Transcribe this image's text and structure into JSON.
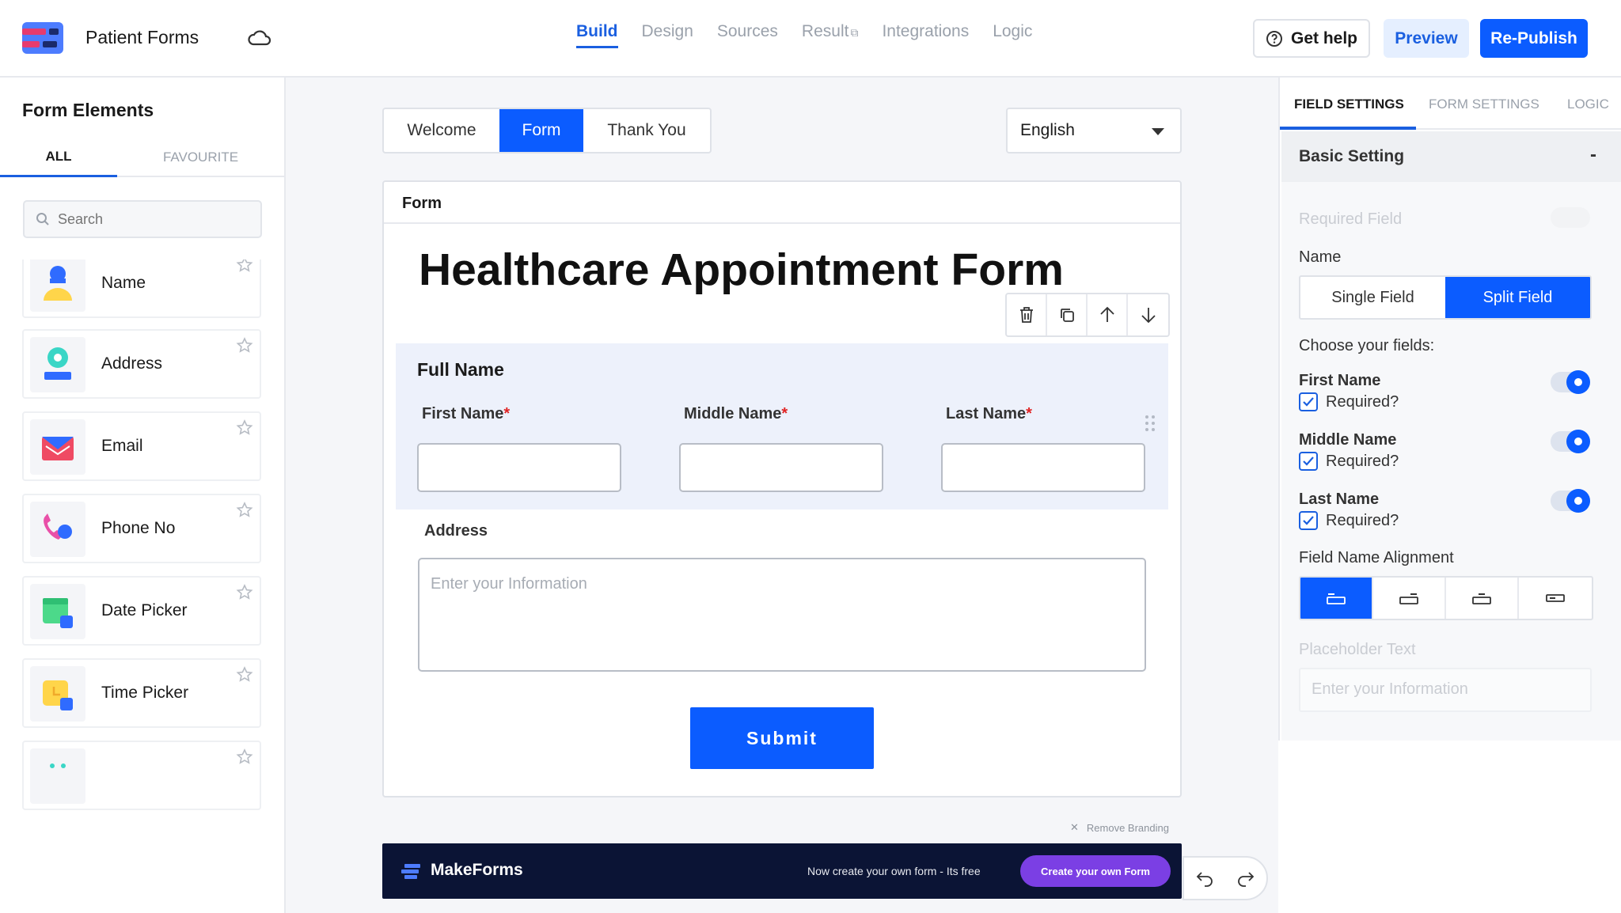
{
  "app": {
    "title": "Patient Forms"
  },
  "nav": {
    "tabs": [
      {
        "label": "Build",
        "active": true
      },
      {
        "label": "Design",
        "active": false
      },
      {
        "label": "Sources",
        "active": false
      },
      {
        "label": "Result",
        "active": false,
        "external": true
      },
      {
        "label": "Integrations",
        "active": false
      },
      {
        "label": "Logic",
        "active": false
      }
    ]
  },
  "header": {
    "help_label": "Get help",
    "preview_label": "Preview",
    "publish_label": "Re-Publish"
  },
  "left_panel": {
    "title": "Form Elements",
    "tabs": {
      "all": "ALL",
      "favourite": "FAVOURITE"
    },
    "search_placeholder": "Search",
    "elements": [
      {
        "label": "Name",
        "icon": "person-icon"
      },
      {
        "label": "Address",
        "icon": "location-icon"
      },
      {
        "label": "Email",
        "icon": "envelope-icon"
      },
      {
        "label": "Phone No",
        "icon": "phone-icon"
      },
      {
        "label": "Date Picker",
        "icon": "calendar-icon"
      },
      {
        "label": "Time Picker",
        "icon": "clock-icon"
      },
      {
        "label": "",
        "icon": "partial-icon"
      }
    ]
  },
  "canvas": {
    "steps": [
      {
        "label": "Welcome",
        "active": false
      },
      {
        "label": "Form",
        "active": true
      },
      {
        "label": "Thank You",
        "active": false
      }
    ],
    "language": "English",
    "card_label": "Form",
    "form_title": "Healthcare Appointment Form",
    "full_name": {
      "title": "Full Name",
      "fields": [
        {
          "label": "First Name",
          "required_mark": "*"
        },
        {
          "label": "Middle Name",
          "required_mark": "*"
        },
        {
          "label": "Last Name",
          "required_mark": "*"
        }
      ]
    },
    "address": {
      "label": "Address",
      "placeholder": "Enter your Information"
    },
    "submit_label": "Submit",
    "remove_branding": "Remove Branding"
  },
  "footer": {
    "brand": "MakeForms",
    "tagline": "Now create your own form - Its free",
    "cta": "Create your own Form"
  },
  "right_panel": {
    "tabs": [
      {
        "label": "FIELD SETTINGS",
        "active": true
      },
      {
        "label": "FORM SETTINGS",
        "active": false
      },
      {
        "label": "LOGIC",
        "active": false
      }
    ],
    "section_title": "Basic Setting",
    "collapse_symbol": "-",
    "required_field_label": "Required Field",
    "name_label": "Name",
    "name_modes": [
      {
        "label": "Single Field",
        "active": false
      },
      {
        "label": "Split Field",
        "active": true
      }
    ],
    "choose_label": "Choose your fields:",
    "fields": [
      {
        "name": "First Name",
        "required_label": "Required?",
        "enabled": true,
        "required": true
      },
      {
        "name": "Middle Name",
        "required_label": "Required?",
        "enabled": true,
        "required": true
      },
      {
        "name": "Last Name",
        "required_label": "Required?",
        "enabled": true,
        "required": true
      }
    ],
    "alignment_label": "Field Name Alignment",
    "placeholder_label": "Placeholder Text",
    "placeholder_value": "Enter your Information"
  },
  "colors": {
    "primary": "#0b5cff",
    "accent_purple": "#7b3fe4",
    "footer_bg": "#0b1435",
    "required": "#e02424"
  }
}
